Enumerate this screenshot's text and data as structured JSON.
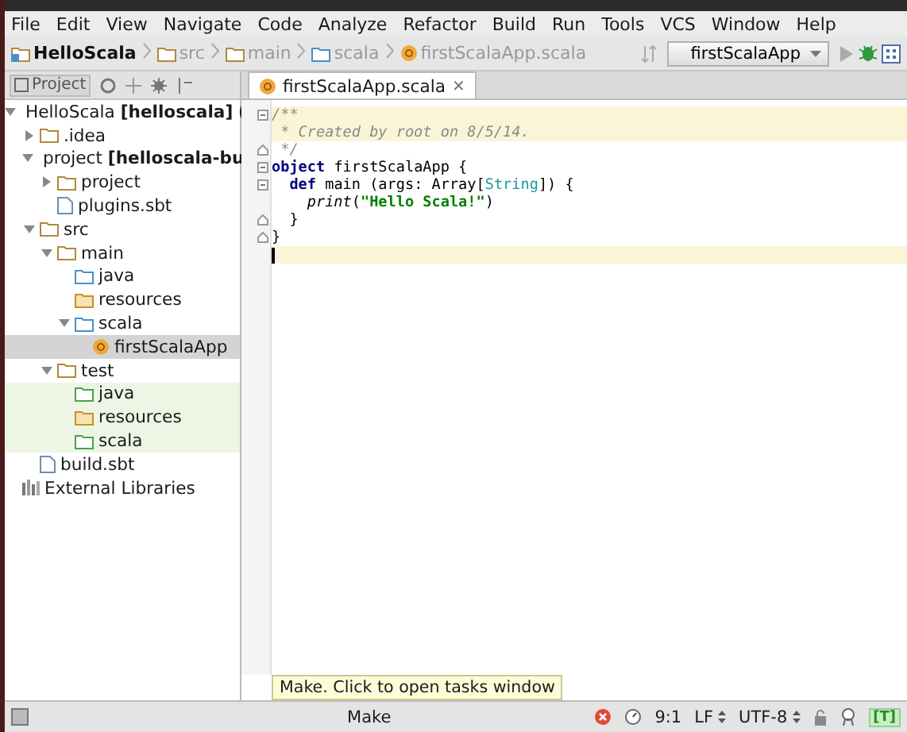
{
  "menu": [
    "File",
    "Edit",
    "View",
    "Navigate",
    "Code",
    "Analyze",
    "Refactor",
    "Build",
    "Run",
    "Tools",
    "VCS",
    "Window",
    "Help"
  ],
  "breadcrumbs": [
    {
      "label": "HelloScala",
      "kind": "module",
      "current": true
    },
    {
      "label": "src",
      "kind": "folder",
      "current": false
    },
    {
      "label": "main",
      "kind": "folder",
      "current": false
    },
    {
      "label": "scala",
      "kind": "source-folder",
      "current": false
    },
    {
      "label": "firstScalaApp.scala",
      "kind": "scala-class",
      "current": false
    }
  ],
  "run_config": {
    "label": "firstScalaApp"
  },
  "project_panel": {
    "title": "Project"
  },
  "tree": [
    {
      "label": "HelloScala **[helloscala]** (",
      "kind": "module",
      "expanded": true,
      "selected": false,
      "test_scope": false,
      "children": [
        {
          "label": ".idea",
          "kind": "folder",
          "expanded": false,
          "selected": false,
          "test_scope": false
        },
        {
          "label": "project **[helloscala-bu**",
          "kind": "module-stack",
          "expanded": true,
          "selected": false,
          "test_scope": false,
          "children": [
            {
              "label": "project",
              "kind": "folder",
              "expanded": false,
              "selected": false,
              "test_scope": false
            },
            {
              "label": "plugins.sbt",
              "kind": "file",
              "selected": false,
              "test_scope": false
            }
          ]
        },
        {
          "label": "src",
          "kind": "folder",
          "expanded": true,
          "selected": false,
          "test_scope": false,
          "children": [
            {
              "label": "main",
              "kind": "folder",
              "expanded": true,
              "selected": false,
              "test_scope": false,
              "children": [
                {
                  "label": "java",
                  "kind": "source-folder",
                  "selected": false,
                  "test_scope": false
                },
                {
                  "label": "resources",
                  "kind": "resource-folder",
                  "selected": false,
                  "test_scope": false
                },
                {
                  "label": "scala",
                  "kind": "source-folder",
                  "expanded": true,
                  "selected": false,
                  "test_scope": false,
                  "children": [
                    {
                      "label": "firstScalaApp",
                      "kind": "scala-class",
                      "selected": true,
                      "test_scope": false
                    }
                  ]
                }
              ]
            },
            {
              "label": "test",
              "kind": "folder",
              "expanded": true,
              "selected": false,
              "test_scope": false,
              "children": [
                {
                  "label": "java",
                  "kind": "test-folder",
                  "selected": false,
                  "test_scope": true
                },
                {
                  "label": "resources",
                  "kind": "resource-folder",
                  "selected": false,
                  "test_scope": true
                },
                {
                  "label": "scala",
                  "kind": "test-folder",
                  "selected": false,
                  "test_scope": true
                }
              ]
            }
          ]
        },
        {
          "label": "build.sbt",
          "kind": "file",
          "selected": false,
          "test_scope": false
        }
      ]
    },
    {
      "label": "External Libraries",
      "kind": "libraries",
      "selected": false,
      "test_scope": false
    }
  ],
  "editor_tabs": [
    {
      "label": "firstScalaApp.scala",
      "close": "×",
      "selected": true
    }
  ],
  "code": [
    {
      "fold_start": true,
      "fold_end": false,
      "highlighted": true,
      "tokens": [
        {
          "text": "/**",
          "kind": "comment"
        }
      ]
    },
    {
      "fold_start": false,
      "fold_end": false,
      "highlighted": true,
      "tokens": [
        {
          "text": " * Created by root on 8/5/14.",
          "kind": "comment"
        }
      ]
    },
    {
      "fold_start": false,
      "fold_end": true,
      "highlighted": false,
      "tokens": [
        {
          "text": " */",
          "kind": "comment"
        }
      ]
    },
    {
      "fold_start": true,
      "fold_end": false,
      "highlighted": false,
      "tokens": [
        {
          "text": "object",
          "kind": "keyword"
        },
        {
          "text": " firstScalaApp {",
          "kind": "plain"
        }
      ]
    },
    {
      "fold_start": true,
      "fold_end": false,
      "highlighted": false,
      "tokens": [
        {
          "text": "  def",
          "kind": "keyword"
        },
        {
          "text": " main (args: Array[",
          "kind": "plain"
        },
        {
          "text": "String",
          "kind": "type"
        },
        {
          "text": "]) {",
          "kind": "plain"
        }
      ]
    },
    {
      "fold_start": false,
      "fold_end": false,
      "highlighted": false,
      "tokens": [
        {
          "text": "    print",
          "kind": "call"
        },
        {
          "text": "(",
          "kind": "plain"
        },
        {
          "text": "\"Hello Scala!\"",
          "kind": "string"
        },
        {
          "text": ")",
          "kind": "plain"
        }
      ]
    },
    {
      "fold_start": false,
      "fold_end": true,
      "highlighted": false,
      "tokens": [
        {
          "text": "  }",
          "kind": "plain"
        }
      ]
    },
    {
      "fold_start": false,
      "fold_end": true,
      "highlighted": false,
      "tokens": [
        {
          "text": "}",
          "kind": "plain"
        }
      ]
    },
    {
      "fold_start": false,
      "fold_end": false,
      "highlighted": true,
      "caret": true
    }
  ],
  "tooltip": {
    "text": "Make. Click to open tasks window"
  },
  "status_bar": {
    "task": "Make",
    "position": "9:1",
    "line_separator": "LF",
    "encoding": "UTF-8",
    "badge": "[T]"
  }
}
